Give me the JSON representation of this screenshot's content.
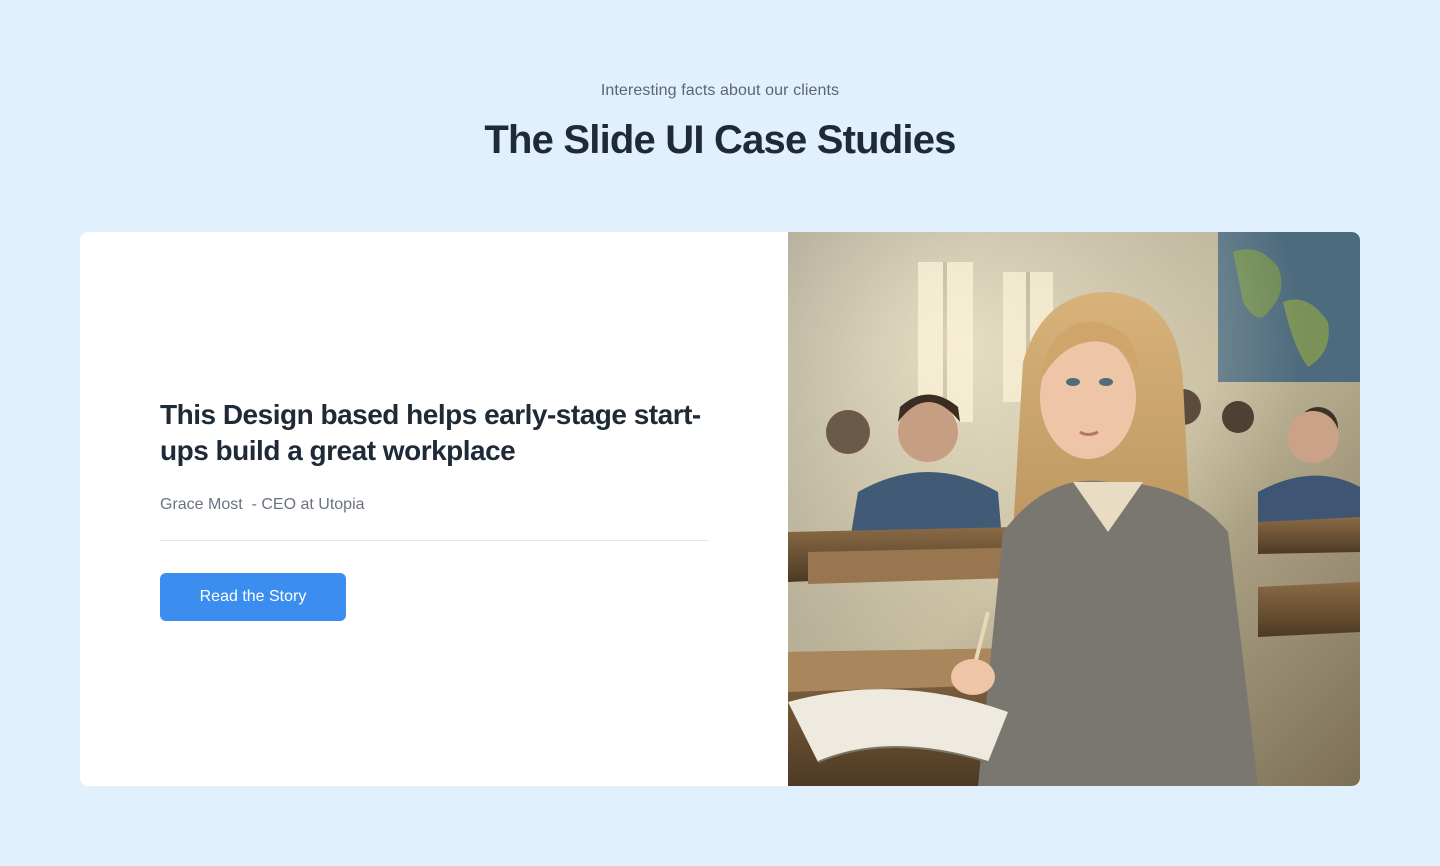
{
  "header": {
    "eyebrow": "Interesting facts about our clients",
    "title": "The Slide UI Case Studies"
  },
  "case_study": {
    "heading": "This Design based helps early-stage start-ups build a great workplace",
    "author": "Grace Most",
    "author_role": " - CEO at Utopia",
    "cta_label": "Read the Story",
    "image_description": "classroom-photo"
  },
  "colors": {
    "page_background": "#e1f0fd",
    "card_background": "#ffffff",
    "accent": "#3b8ef0",
    "heading_text": "#1f2a37",
    "muted_text": "#6b7280"
  }
}
